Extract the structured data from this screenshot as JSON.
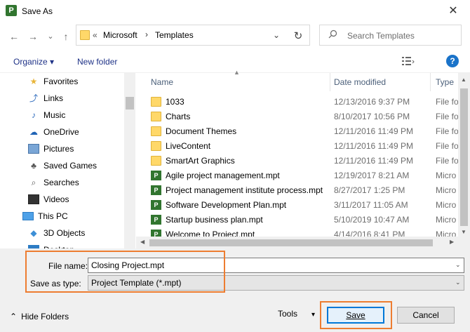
{
  "window": {
    "title": "Save As",
    "app_icon_label": "P",
    "close_glyph": "✕"
  },
  "nav_buttons": {
    "back": "←",
    "forward": "→",
    "down": "⌄",
    "up": "↑"
  },
  "address": {
    "overflow": "«",
    "crumbs": [
      "Microsoft",
      "Templates"
    ],
    "separator": "›",
    "dropdown": "⌄",
    "refresh": "↻"
  },
  "search": {
    "placeholder": "Search Templates",
    "icon": "search-icon"
  },
  "toolbar": {
    "organize": "Organize ▾",
    "new_folder": "New folder",
    "view": "view-options-icon",
    "help": "?"
  },
  "sidebar": {
    "items": [
      {
        "label": "Favorites",
        "icon": "star-icon"
      },
      {
        "label": "Links",
        "icon": "links-icon"
      },
      {
        "label": "Music",
        "icon": "music-icon"
      },
      {
        "label": "OneDrive",
        "icon": "onedrive-icon"
      },
      {
        "label": "Pictures",
        "icon": "pictures-icon"
      },
      {
        "label": "Saved Games",
        "icon": "saved-games-icon"
      },
      {
        "label": "Searches",
        "icon": "searches-icon"
      },
      {
        "label": "Videos",
        "icon": "videos-icon"
      },
      {
        "label": "This PC",
        "icon": "this-pc-icon"
      },
      {
        "label": "3D Objects",
        "icon": "3d-objects-icon"
      },
      {
        "label": "Desktop",
        "icon": "desktop-icon"
      }
    ]
  },
  "columns": {
    "name": "Name",
    "date": "Date modified",
    "type": "Type"
  },
  "files": [
    {
      "name": "1033",
      "date": "12/13/2016 9:37 PM",
      "type": "File fo",
      "kind": "folder"
    },
    {
      "name": "Charts",
      "date": "8/10/2017 10:56 PM",
      "type": "File fo",
      "kind": "folder"
    },
    {
      "name": "Document Themes",
      "date": "12/11/2016 11:49 PM",
      "type": "File fo",
      "kind": "folder"
    },
    {
      "name": "LiveContent",
      "date": "12/11/2016 11:49 PM",
      "type": "File fo",
      "kind": "folder"
    },
    {
      "name": "SmartArt Graphics",
      "date": "12/11/2016 11:49 PM",
      "type": "File fo",
      "kind": "folder"
    },
    {
      "name": "Agile project management.mpt",
      "date": "12/19/2017 8:21 AM",
      "type": "Micro",
      "kind": "mpt"
    },
    {
      "name": "Project management institute process.mpt",
      "date": "8/27/2017 1:25 PM",
      "type": "Micro",
      "kind": "mpt"
    },
    {
      "name": "Software Development Plan.mpt",
      "date": "3/11/2017 11:05 AM",
      "type": "Micro",
      "kind": "mpt"
    },
    {
      "name": "Startup business plan.mpt",
      "date": "5/10/2019 10:47 AM",
      "type": "Micro",
      "kind": "mpt"
    },
    {
      "name": "Welcome to Project.mpt",
      "date": "4/14/2016 8:41 PM",
      "type": "Micro",
      "kind": "mpt"
    }
  ],
  "form": {
    "file_name_label": "File name:",
    "file_name_value": "Closing Project.mpt",
    "save_type_label": "Save as type:",
    "save_type_value": "Project Template (*.mpt)",
    "dropdown_glyph": "⌄"
  },
  "footer": {
    "hide_folders": "Hide Folders",
    "hide_glyph": "⌃",
    "tools": "Tools",
    "tools_glyph": "▾",
    "save": "Save",
    "cancel": "Cancel"
  },
  "colors": {
    "accent": "#0078d7",
    "highlight": "#ed7d31",
    "project_green": "#31752f",
    "folder": "#ffd869"
  }
}
